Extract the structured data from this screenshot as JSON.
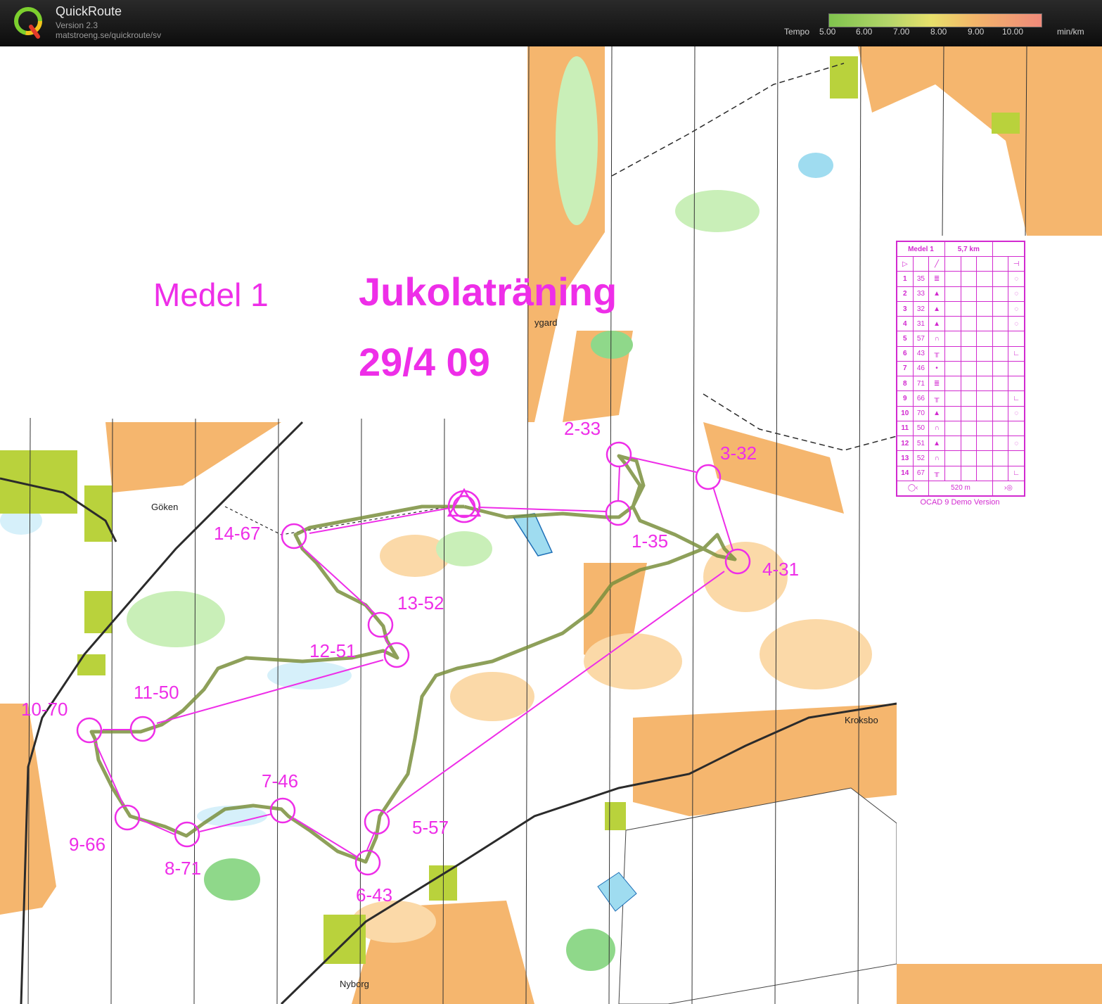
{
  "app": {
    "name": "QuickRoute",
    "version": "Version 2.3",
    "url": "matstroeng.se/quickroute/sv"
  },
  "tempo": {
    "label": "Tempo",
    "ticks": [
      "5.00",
      "6.00",
      "7.00",
      "8.00",
      "9.00",
      "10.00"
    ],
    "unit": "min/km"
  },
  "map_title": {
    "class": "Medel 1",
    "event": "Jukolaträning",
    "date": "29/4 09"
  },
  "place_names": {
    "goken": "Göken",
    "nyborg": "Nyborg",
    "kroksbo": "Kroksbo",
    "gard": "ygard"
  },
  "controls": [
    {
      "label": "1-35"
    },
    {
      "label": "2-33"
    },
    {
      "label": "3-32"
    },
    {
      "label": "4-31"
    },
    {
      "label": "5-57"
    },
    {
      "label": "6-43"
    },
    {
      "label": "7-46"
    },
    {
      "label": "8-71"
    },
    {
      "label": "9-66"
    },
    {
      "label": "10-70"
    },
    {
      "label": "11-50"
    },
    {
      "label": "12-51"
    },
    {
      "label": "13-52"
    },
    {
      "label": "14-67"
    }
  ],
  "course_card": {
    "name": "Medel 1",
    "length": "5,7 km",
    "rows": [
      [
        "1",
        "35"
      ],
      [
        "2",
        "33"
      ],
      [
        "3",
        "32"
      ],
      [
        "4",
        "31"
      ],
      [
        "5",
        "57"
      ],
      [
        "6",
        "43"
      ],
      [
        "7",
        "46"
      ],
      [
        "8",
        "71"
      ],
      [
        "9",
        "66"
      ],
      [
        "10",
        "70"
      ],
      [
        "11",
        "50"
      ],
      [
        "12",
        "51"
      ],
      [
        "13",
        "52"
      ],
      [
        "14",
        "67"
      ]
    ],
    "finish_distance": "520 m",
    "note": "OCAD 9 Demo Version"
  },
  "colors": {
    "course": "#ee2ee8",
    "open": "#f5b66e",
    "forest": "#ffffff",
    "green": "#8fd88a",
    "lightgreen": "#c9efb8",
    "yellowgreen": "#b9d23c",
    "water": "#9fdcf0"
  }
}
